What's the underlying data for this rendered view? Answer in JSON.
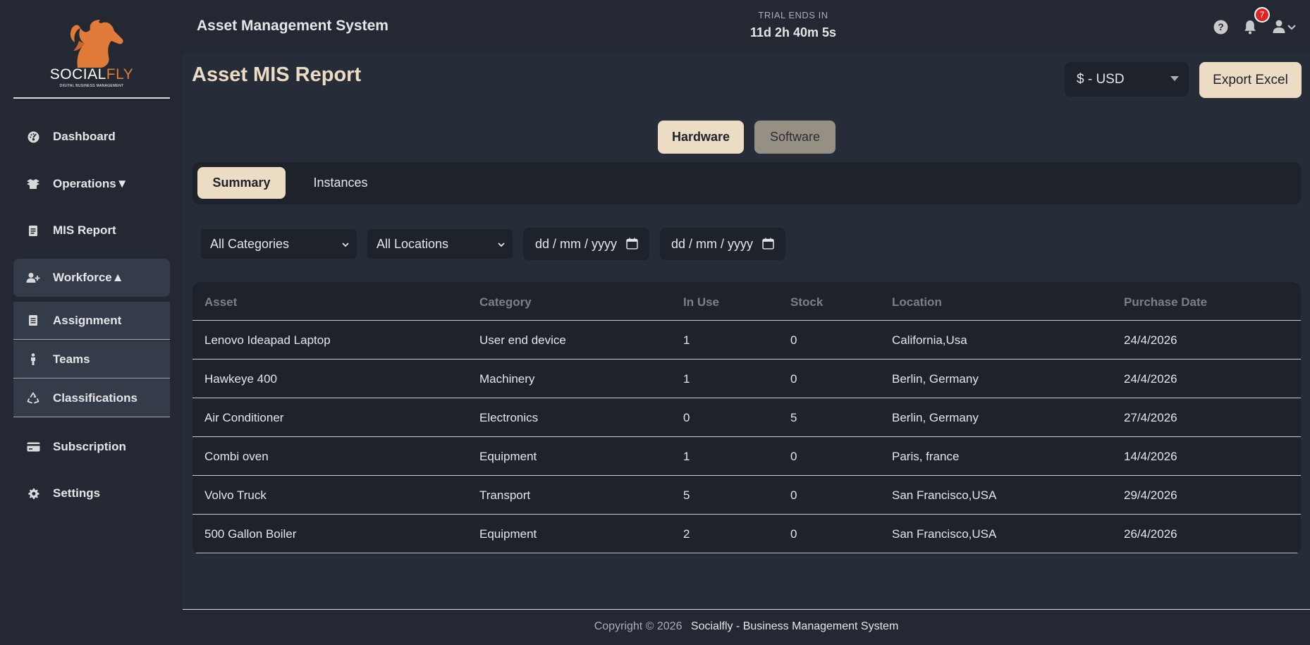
{
  "brand": {
    "name_part1": "SOCIAL",
    "name_part2": "FLY",
    "tagline": "DIGITAL BUSINESS MANAGEMENT"
  },
  "sidebar": {
    "items": [
      {
        "label": "Dashboard",
        "icon": "dashboard-gauge-icon"
      },
      {
        "label": "Operations▼",
        "icon": "box-icon"
      },
      {
        "label": "MIS Report",
        "icon": "report-icon"
      },
      {
        "label": "Workforce▲",
        "icon": "add-user-icon"
      },
      {
        "label": "Assignment",
        "icon": "clipboard-icon"
      },
      {
        "label": "Teams",
        "icon": "person-icon"
      },
      {
        "label": "Classifications",
        "icon": "recycle-icon"
      },
      {
        "label": "Subscription",
        "icon": "credit-card-icon"
      },
      {
        "label": "Settings",
        "icon": "gear-icon"
      }
    ]
  },
  "header": {
    "title": "Asset Management System",
    "trial_label": "TRIAL ENDS IN",
    "trial_time": "11d 2h 40m 5s",
    "notification_count": "7"
  },
  "main": {
    "page_title": "Asset MIS Report",
    "currency": "$ - USD",
    "export_label": "Export Excel",
    "asset_types": [
      "Hardware",
      "Software"
    ],
    "tabs": [
      "Summary",
      "Instances"
    ],
    "filters": {
      "category": "All Categories",
      "location": "All Locations",
      "date_from": "dd / mm / yyyy",
      "date_to": "dd / mm / yyyy"
    }
  },
  "table": {
    "columns": [
      "Asset",
      "Category",
      "In Use",
      "Stock",
      "Location",
      "Purchase Date"
    ],
    "rows": [
      [
        "Lenovo Ideapad Laptop",
        "User end device",
        "1",
        "0",
        "California,Usa",
        "24/4/2026"
      ],
      [
        "Hawkeye 400",
        "Machinery",
        "1",
        "0",
        "Berlin, Germany",
        "24/4/2026"
      ],
      [
        "Air Conditioner",
        "Electronics",
        "0",
        "5",
        "Berlin, Germany",
        "27/4/2026"
      ],
      [
        "Combi oven",
        "Equipment",
        "1",
        "0",
        "Paris, france",
        "14/4/2026"
      ],
      [
        "Volvo Truck",
        "Transport",
        "5",
        "0",
        "San Francisco,USA",
        "29/4/2026"
      ],
      [
        "500 Gallon Boiler",
        "Equipment",
        "2",
        "0",
        "San Francisco,USA",
        "26/4/2026"
      ]
    ]
  },
  "footer": {
    "copyright": "Copyright © 2026",
    "brand": "Socialfly - Business Management System"
  },
  "colors": {
    "accent": "#ecdcc3",
    "background": "#272d38",
    "panel": "#1d222b",
    "badge": "#e02424",
    "logo_orange": "#e07b39"
  }
}
